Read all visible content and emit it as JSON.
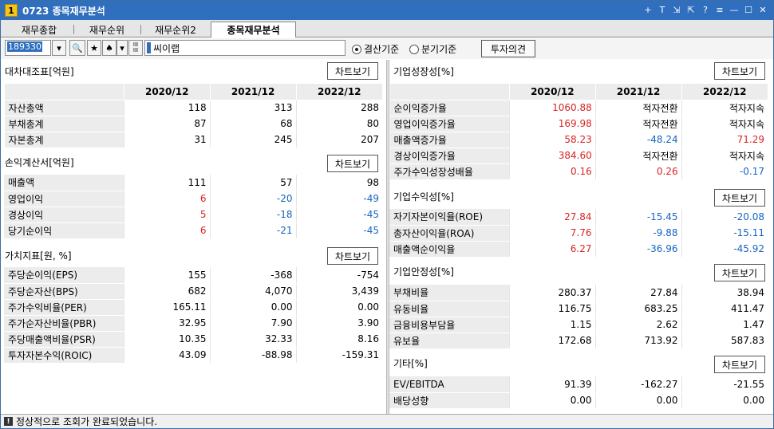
{
  "window": {
    "number": "1",
    "title": "0723 종목재무분석",
    "tools": [
      "+",
      "T",
      "⇲",
      "⇱",
      "?",
      "≡",
      "—",
      "☐",
      "✕"
    ]
  },
  "tabs": [
    "재무종합",
    "재무순위",
    "재무순위2",
    "종목재무분석"
  ],
  "toolbar": {
    "code": "189330",
    "company": "씨이랩",
    "radio1": "결산기준",
    "radio2": "분기기준",
    "invest_button": "투자의견",
    "star": "★",
    "spade": "♠"
  },
  "left": {
    "balance": {
      "title": "대차대조표[억원]",
      "chart_btn": "차트보기",
      "headers": [
        "2020/12",
        "2021/12",
        "2022/12"
      ],
      "rows": [
        {
          "label": "자산총액",
          "values": [
            "118",
            "313",
            "288"
          ],
          "colors": [
            "",
            "",
            ""
          ]
        },
        {
          "label": "부채총계",
          "values": [
            "87",
            "68",
            "80"
          ],
          "colors": [
            "",
            "",
            ""
          ]
        },
        {
          "label": "자본총계",
          "values": [
            "31",
            "245",
            "207"
          ],
          "colors": [
            "",
            "",
            ""
          ]
        }
      ]
    },
    "income": {
      "title": "손익계산서[억원]",
      "chart_btn": "차트보기",
      "rows": [
        {
          "label": "매출액",
          "values": [
            "111",
            "57",
            "98"
          ],
          "colors": [
            "",
            "",
            ""
          ]
        },
        {
          "label": "영업이익",
          "values": [
            "6",
            "-20",
            "-49"
          ],
          "colors": [
            "red",
            "blue",
            "blue"
          ]
        },
        {
          "label": "경상이익",
          "values": [
            "5",
            "-18",
            "-45"
          ],
          "colors": [
            "red",
            "blue",
            "blue"
          ]
        },
        {
          "label": "당기순이익",
          "values": [
            "6",
            "-21",
            "-45"
          ],
          "colors": [
            "red",
            "blue",
            "blue"
          ]
        }
      ]
    },
    "value": {
      "title": "가치지표[원, %]",
      "chart_btn": "차트보기",
      "rows": [
        {
          "label": "주당순이익(EPS)",
          "values": [
            "155",
            "-368",
            "-754"
          ],
          "colors": [
            "",
            "",
            ""
          ]
        },
        {
          "label": "주당순자산(BPS)",
          "values": [
            "682",
            "4,070",
            "3,439"
          ],
          "colors": [
            "",
            "",
            ""
          ]
        },
        {
          "label": "주가수익비율(PER)",
          "values": [
            "165.11",
            "0.00",
            "0.00"
          ],
          "colors": [
            "",
            "",
            ""
          ]
        },
        {
          "label": "주가순자산비율(PBR)",
          "values": [
            "32.95",
            "7.90",
            "3.90"
          ],
          "colors": [
            "",
            "",
            ""
          ]
        },
        {
          "label": "주당매출액비율(PSR)",
          "values": [
            "10.35",
            "32.33",
            "8.16"
          ],
          "colors": [
            "",
            "",
            ""
          ]
        },
        {
          "label": "투자자본수익(ROIC)",
          "values": [
            "43.09",
            "-88.98",
            "-159.31"
          ],
          "colors": [
            "",
            "",
            ""
          ]
        }
      ]
    }
  },
  "right": {
    "growth": {
      "title": "기업성장성[%]",
      "chart_btn": "차트보기",
      "headers": [
        "2020/12",
        "2021/12",
        "2022/12"
      ],
      "rows": [
        {
          "label": "순이익증가율",
          "values": [
            "1060.88",
            "적자전환",
            "적자지속"
          ],
          "colors": [
            "red",
            "",
            ""
          ]
        },
        {
          "label": "영업이익증가율",
          "values": [
            "169.98",
            "적자전환",
            "적자지속"
          ],
          "colors": [
            "red",
            "",
            ""
          ]
        },
        {
          "label": "매출액증가율",
          "values": [
            "58.23",
            "-48.24",
            "71.29"
          ],
          "colors": [
            "red",
            "blue",
            "red"
          ]
        },
        {
          "label": "경상이익증가율",
          "values": [
            "384.60",
            "적자전환",
            "적자지속"
          ],
          "colors": [
            "red",
            "",
            ""
          ]
        },
        {
          "label": "주가수익성장성배율",
          "values": [
            "0.16",
            "0.26",
            "-0.17"
          ],
          "colors": [
            "red",
            "red",
            "blue"
          ]
        }
      ]
    },
    "profit": {
      "title": "기업수익성[%]",
      "chart_btn": "차트보기",
      "rows": [
        {
          "label": "자기자본이익율(ROE)",
          "values": [
            "27.84",
            "-15.45",
            "-20.08"
          ],
          "colors": [
            "red",
            "blue",
            "blue"
          ]
        },
        {
          "label": "총자산이익율(ROA)",
          "values": [
            "7.76",
            "-9.88",
            "-15.11"
          ],
          "colors": [
            "red",
            "blue",
            "blue"
          ]
        },
        {
          "label": "매출액순이익율",
          "values": [
            "6.27",
            "-36.96",
            "-45.92"
          ],
          "colors": [
            "red",
            "blue",
            "blue"
          ]
        }
      ]
    },
    "stability": {
      "title": "기업안정성[%]",
      "chart_btn": "차트보기",
      "rows": [
        {
          "label": "부채비율",
          "values": [
            "280.37",
            "27.84",
            "38.94"
          ],
          "colors": [
            "",
            "",
            ""
          ]
        },
        {
          "label": "유동비율",
          "values": [
            "116.75",
            "683.25",
            "411.47"
          ],
          "colors": [
            "",
            "",
            ""
          ]
        },
        {
          "label": "금융비용부담율",
          "values": [
            "1.15",
            "2.62",
            "1.47"
          ],
          "colors": [
            "",
            "",
            ""
          ]
        },
        {
          "label": "유보율",
          "values": [
            "172.68",
            "713.92",
            "587.83"
          ],
          "colors": [
            "",
            "",
            ""
          ]
        }
      ]
    },
    "etc": {
      "title": "기타[%]",
      "chart_btn": "차트보기",
      "rows": [
        {
          "label": "EV/EBITDA",
          "values": [
            "91.39",
            "-162.27",
            "-21.55"
          ],
          "colors": [
            "",
            "",
            ""
          ]
        },
        {
          "label": "배당성향",
          "values": [
            "0.00",
            "0.00",
            "0.00"
          ],
          "colors": [
            "",
            "",
            ""
          ]
        }
      ]
    }
  },
  "status": {
    "icon": "!",
    "text": "정상적으로 조회가 완료되었습니다."
  }
}
